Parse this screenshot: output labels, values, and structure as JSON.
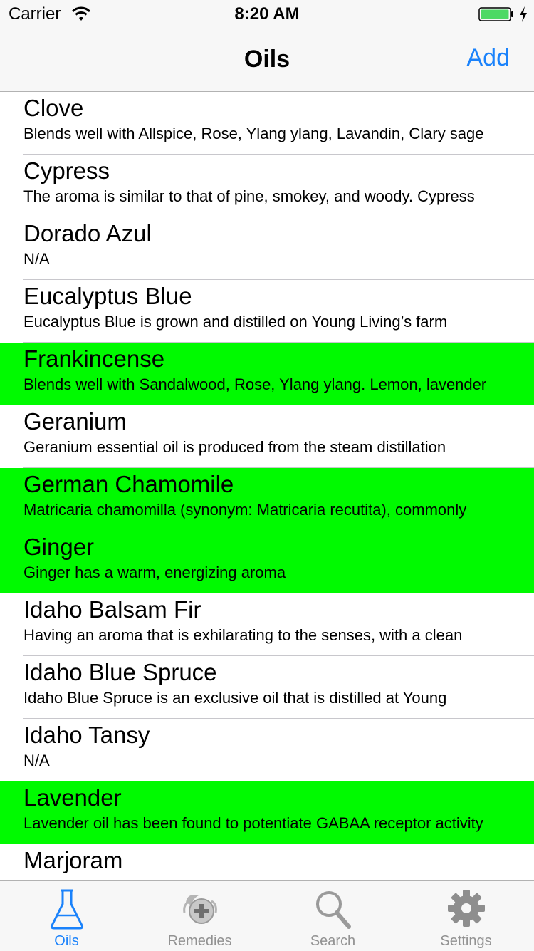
{
  "status_bar": {
    "carrier": "Carrier",
    "time": "8:20 AM"
  },
  "nav": {
    "title": "Oils",
    "add_label": "Add"
  },
  "list": [
    {
      "title": "Clove",
      "subtitle": "Blends well with Allspice, Rose, Ylang ylang, Lavandin, Clary sage",
      "highlighted": false
    },
    {
      "title": "Cypress",
      "subtitle": "The aroma is similar to that of pine, smokey, and woody.  Cypress",
      "highlighted": false
    },
    {
      "title": "Dorado Azul",
      "subtitle": "N/A",
      "highlighted": false
    },
    {
      "title": "Eucalyptus Blue",
      "subtitle": "Eucalyptus Blue is grown and distilled on Young Living’s farm",
      "highlighted": false
    },
    {
      "title": "Frankincense",
      "subtitle": "Blends well with Sandalwood, Rose, Ylang ylang. Lemon, lavender",
      "highlighted": true
    },
    {
      "title": "Geranium",
      "subtitle": "Geranium essential oil is produced from the steam distillation",
      "highlighted": false
    },
    {
      "title": "German Chamomile",
      "subtitle": "Matricaria chamomilla (synonym: Matricaria recutita), commonly",
      "highlighted": true
    },
    {
      "title": "Ginger",
      "subtitle": "Ginger has a warm, energizing aroma",
      "highlighted": true
    },
    {
      "title": "Idaho Balsam Fir",
      "subtitle": "Having an aroma that is exhilarating to the senses, with a clean",
      "highlighted": false
    },
    {
      "title": "Idaho Blue Spruce",
      "subtitle": "Idaho Blue Spruce is an exclusive oil that is distilled at Young",
      "highlighted": false
    },
    {
      "title": "Idaho Tansy",
      "subtitle": "N/A",
      "highlighted": false
    },
    {
      "title": "Lavender",
      "subtitle": "Lavender oil has been found to potentiate GABAA receptor activity",
      "highlighted": true
    },
    {
      "title": "Marjoram",
      "subtitle": "Marjoram has been distilled in the Dalmatian region",
      "highlighted": false
    }
  ],
  "tabs": [
    {
      "label": "Oils",
      "icon": "flask-icon",
      "active": true
    },
    {
      "label": "Remedies",
      "icon": "remedies-icon",
      "active": false
    },
    {
      "label": "Search",
      "icon": "search-icon",
      "active": false
    },
    {
      "label": "Settings",
      "icon": "gear-icon",
      "active": false
    }
  ],
  "colors": {
    "accent": "#1a82fb",
    "highlight": "#00fa00",
    "tab_inactive": "#929292"
  }
}
